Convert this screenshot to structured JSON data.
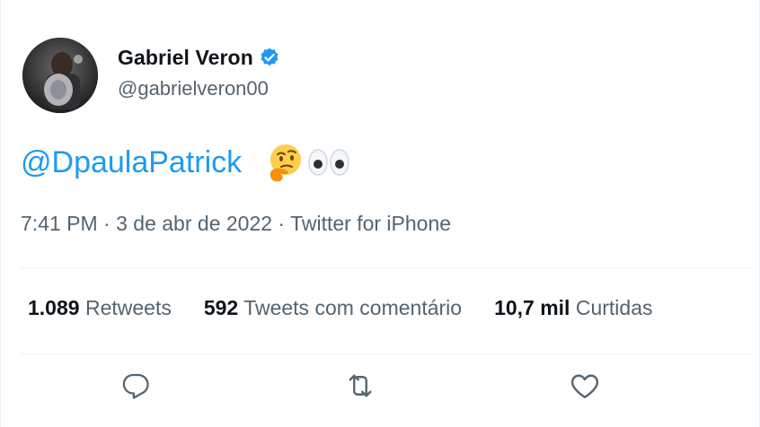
{
  "author": {
    "display_name": "Gabriel Veron",
    "handle": "@gabrielveron00",
    "verified": true
  },
  "tweet": {
    "mention": "@DpaulaPatrick",
    "emojis": [
      "thinking-face",
      "eyes"
    ]
  },
  "meta": {
    "time": "7:41 PM",
    "sep1": " · ",
    "date": "3 de abr de 2022",
    "sep2": " · ",
    "source": "Twitter for iPhone"
  },
  "stats": [
    {
      "value": "1.089",
      "label": "Retweets"
    },
    {
      "value": "592",
      "label": "Tweets com comentário"
    },
    {
      "value": "10,7 mil",
      "label": "Curtidas"
    }
  ],
  "actions": [
    "reply-icon",
    "retweet-icon",
    "like-icon"
  ],
  "colors": {
    "link": "#1d9bf0",
    "verified": "#1d9bf0",
    "secondary_text": "#536471",
    "primary_text": "#0f1419"
  }
}
